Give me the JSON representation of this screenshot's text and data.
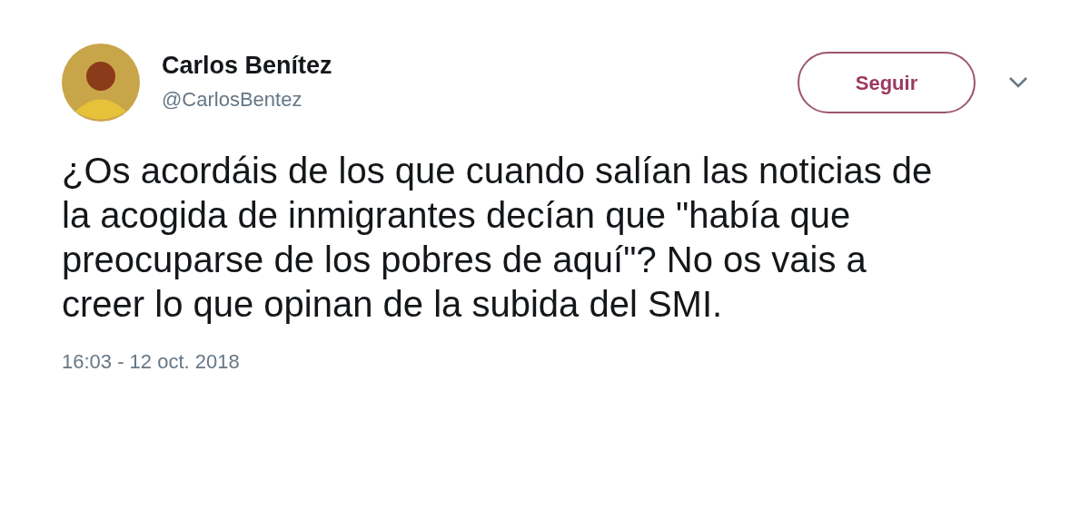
{
  "author": {
    "name": "Carlos Benítez",
    "handle": "@CarlosBentez"
  },
  "follow_button": "Seguir",
  "tweet": {
    "text": "¿Os acordáis de los que cuando salían las noticias de la acogida de inmigrantes decían que \"había que preocuparse de los pobres de aquí\"? No os vais a creer lo que opinan de la subida del SMI.",
    "timestamp": "16:03 - 12 oct. 2018"
  }
}
